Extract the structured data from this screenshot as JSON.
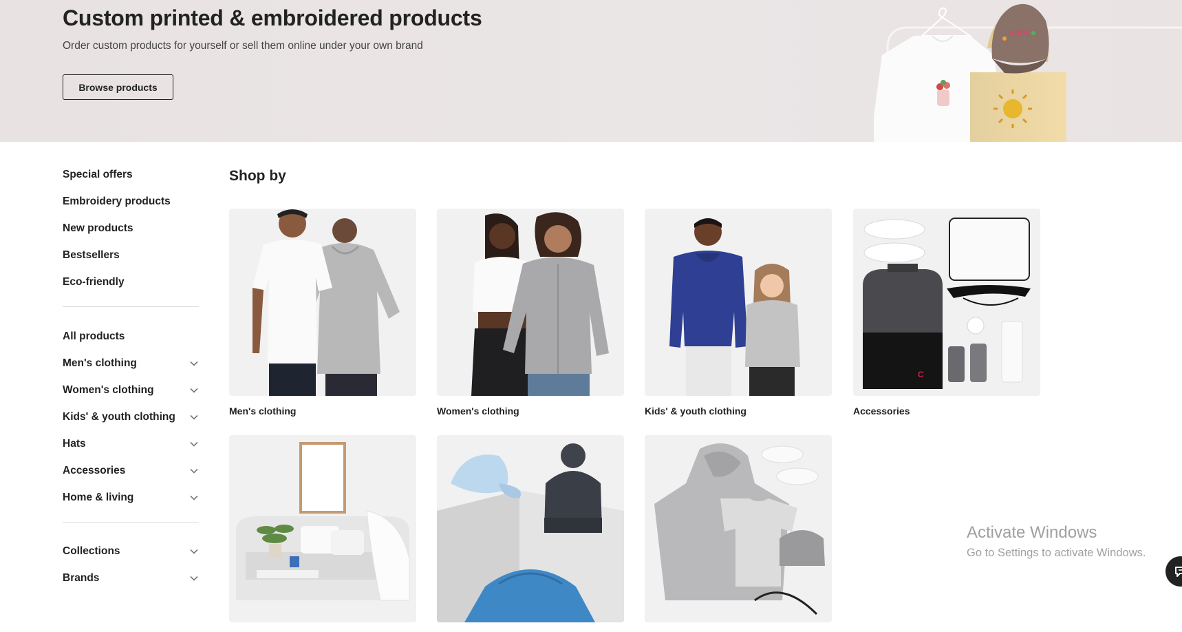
{
  "hero": {
    "title": "Custom printed & embroidered products",
    "subtitle": "Order custom products for yourself or sell them online under your own brand",
    "button_label": "Browse products"
  },
  "sidebar": {
    "group1": [
      "Special offers",
      "Embroidery products",
      "New products",
      "Bestsellers",
      "Eco-friendly"
    ],
    "group2": [
      {
        "label": "All products",
        "expandable": false
      },
      {
        "label": "Men's clothing",
        "expandable": true
      },
      {
        "label": "Women's clothing",
        "expandable": true
      },
      {
        "label": "Kids' & youth clothing",
        "expandable": true
      },
      {
        "label": "Hats",
        "expandable": true
      },
      {
        "label": "Accessories",
        "expandable": true
      },
      {
        "label": "Home & living",
        "expandable": true
      }
    ],
    "group3": [
      {
        "label": "Collections",
        "expandable": true
      },
      {
        "label": "Brands",
        "expandable": true
      }
    ]
  },
  "main": {
    "heading": "Shop by",
    "categories": [
      {
        "label": "Men's clothing",
        "icon": "mens-clothing-image"
      },
      {
        "label": "Women's clothing",
        "icon": "womens-clothing-image"
      },
      {
        "label": "Kids' & youth clothing",
        "icon": "kids-clothing-image"
      },
      {
        "label": "Accessories",
        "icon": "accessories-image"
      },
      {
        "label": "",
        "icon": "home-living-image"
      },
      {
        "label": "",
        "icon": "hats-image"
      },
      {
        "label": "",
        "icon": "all-products-image"
      }
    ]
  },
  "watermark": {
    "line1": "Activate Windows",
    "line2": "Go to Settings to activate Windows."
  },
  "colors": {
    "hero_bg": "#e9e3e3",
    "text": "#222222",
    "card_bg": "#f1f1f1",
    "divider": "#dcdcdc"
  }
}
